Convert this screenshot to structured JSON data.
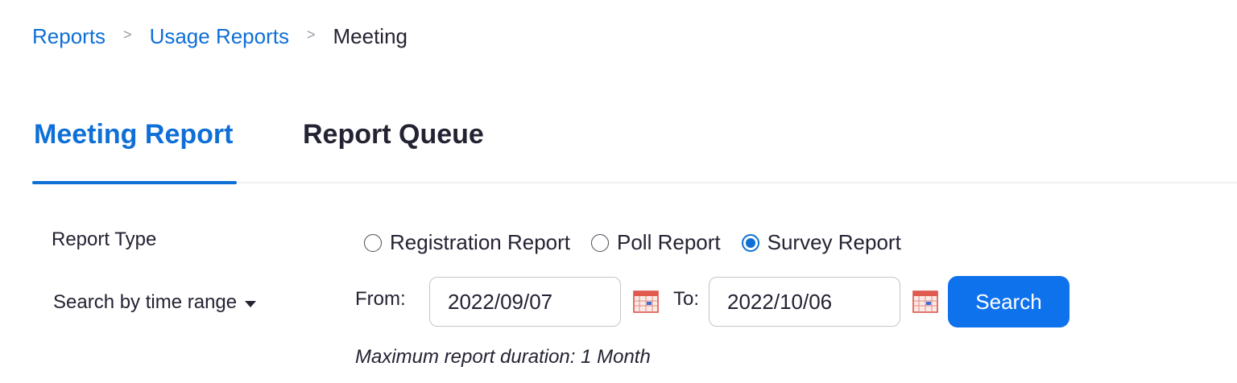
{
  "breadcrumb": {
    "items": [
      {
        "label": "Reports",
        "link": true
      },
      {
        "label": "Usage Reports",
        "link": true
      },
      {
        "label": "Meeting",
        "link": false
      }
    ],
    "separator": ">"
  },
  "tabs": [
    {
      "label": "Meeting Report",
      "active": true
    },
    {
      "label": "Report Queue",
      "active": false
    }
  ],
  "form": {
    "report_type_label": "Report Type",
    "report_types": [
      {
        "label": "Registration Report",
        "checked": false
      },
      {
        "label": "Poll Report",
        "checked": false
      },
      {
        "label": "Survey Report",
        "checked": true
      }
    ],
    "search_by_label": "Search by time range",
    "from_label": "From:",
    "from_value": "2022/09/07",
    "to_label": "To:",
    "to_value": "2022/10/06",
    "search_button": "Search",
    "note": "Maximum report duration: 1 Month"
  },
  "colors": {
    "accent": "#0e6fd6",
    "button": "#0e72ed",
    "text": "#232333"
  },
  "icons": {
    "calendar": "calendar-icon",
    "dropdown": "caret-down-icon"
  }
}
